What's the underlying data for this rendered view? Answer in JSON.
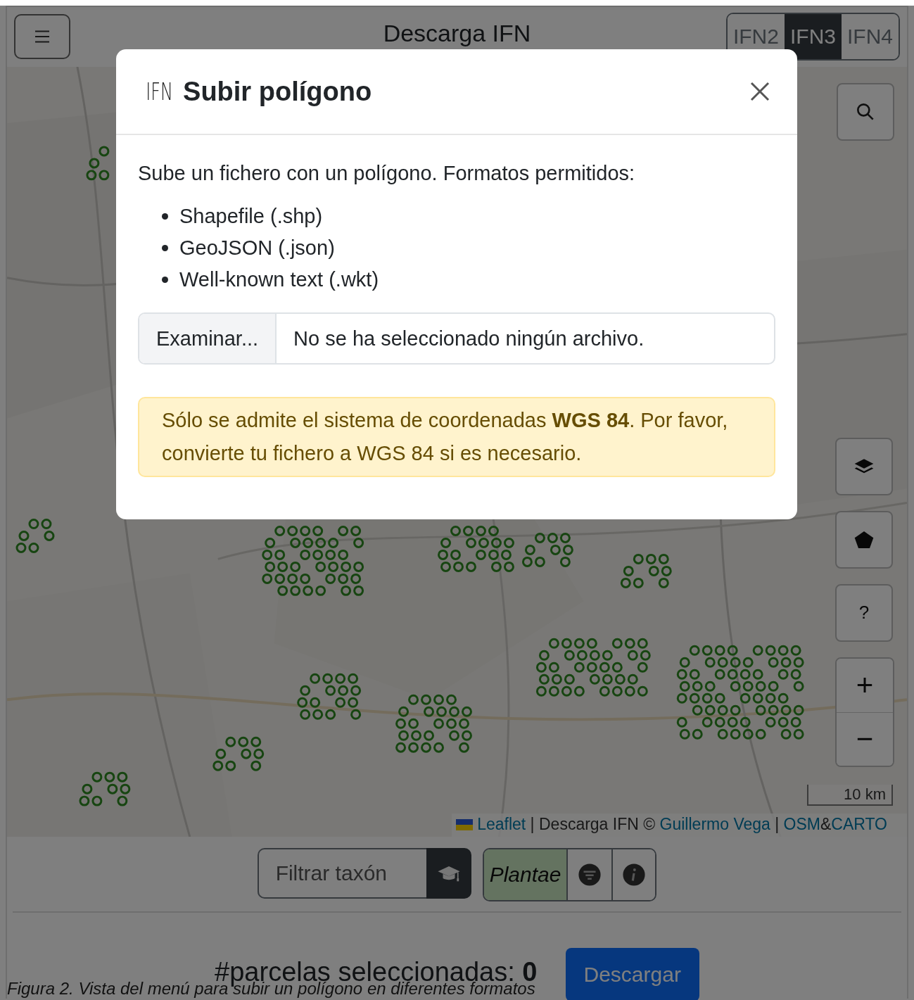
{
  "header": {
    "title": "Descarga IFN",
    "inventories": [
      {
        "label": "IFN2",
        "selected": false
      },
      {
        "label": "IFN3",
        "selected": true
      },
      {
        "label": "IFN4",
        "selected": false
      }
    ]
  },
  "map": {
    "kind": "picture",
    "scale": "10 km",
    "attribution": [
      {
        "text": "Leaflet",
        "kind": "link"
      },
      {
        "text": " | Descarga IFN © ",
        "kind": "text"
      },
      {
        "text": "Guillermo Vega",
        "kind": "link"
      },
      {
        "text": " | ",
        "kind": "text"
      },
      {
        "text": "OSM",
        "kind": "link"
      },
      {
        "text": "&",
        "kind": "text"
      },
      {
        "text": "CARTO",
        "kind": "link"
      }
    ]
  },
  "map_controls": [
    {
      "kind": "search"
    },
    {
      "kind": "layers"
    },
    {
      "kind": "polygon"
    },
    {
      "kind": "text",
      "label": "?"
    },
    {
      "kind": "zoom",
      "zoom_in": "+",
      "zoom_out": "−"
    }
  ],
  "filter": {
    "placeholder": "Filtrar taxón",
    "taxon": "Plantae"
  },
  "summary": {
    "label": "#parcelas seleccionadas:",
    "count": "0",
    "button": "Descargar"
  },
  "modal": {
    "logo": "IFN",
    "title": "Subir polígono",
    "intro": "Sube un fichero con un polígono. Formatos permitidos:",
    "formats": [
      "Shapefile (.shp)",
      "GeoJSON (.json)",
      "Well-known text (.wkt)"
    ],
    "browse_button": "Examinar...",
    "file_status": "No se ha seleccionado ningún archivo.",
    "alert": "Sólo se admite el sistema de coordenadas **WGS 84**. Por favor, convierte tu fichero a WGS 84 si es necesario."
  },
  "caption": "Figura 2. Vista del menú para subir un polígono en diferentes formatos"
}
